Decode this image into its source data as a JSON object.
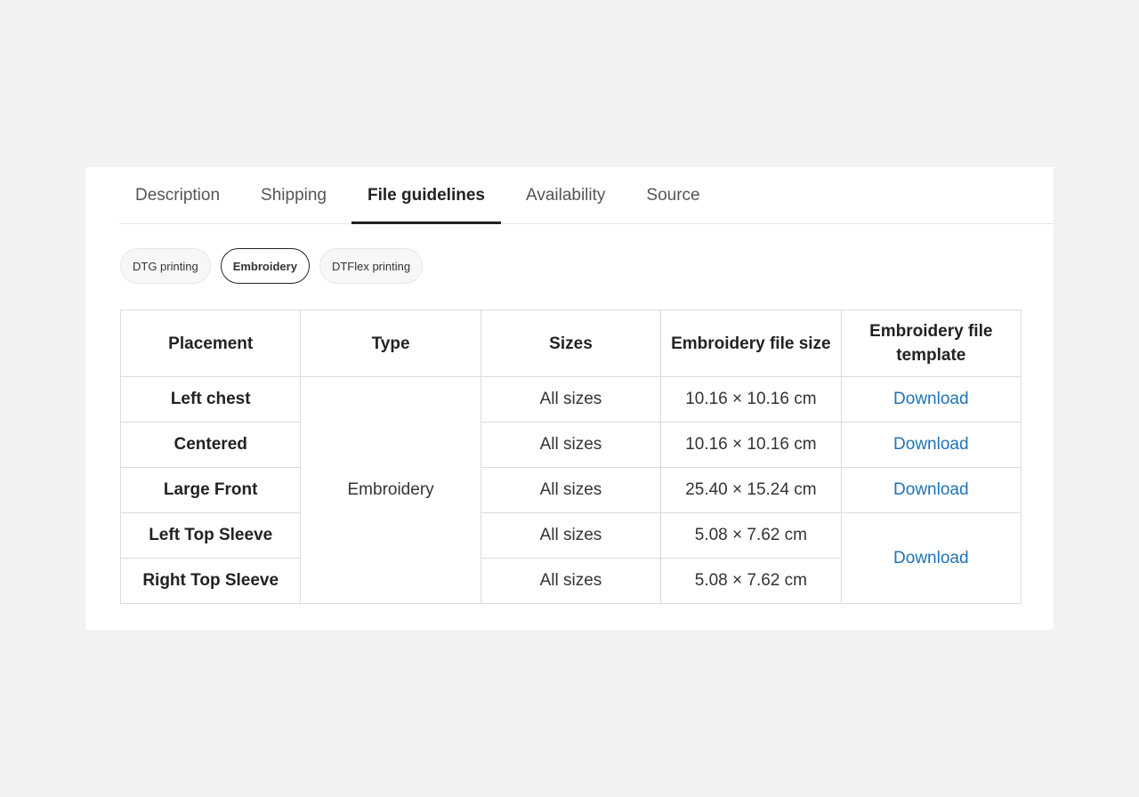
{
  "tabs": [
    {
      "label": "Description",
      "active": false
    },
    {
      "label": "Shipping",
      "active": false
    },
    {
      "label": "File guidelines",
      "active": true
    },
    {
      "label": "Availability",
      "active": false
    },
    {
      "label": "Source",
      "active": false
    }
  ],
  "pills": [
    {
      "label": "DTG printing",
      "active": false
    },
    {
      "label": "Embroidery",
      "active": true
    },
    {
      "label": "DTFlex printing",
      "active": false
    }
  ],
  "table": {
    "headers": [
      "Placement",
      "Type",
      "Sizes",
      "Embroidery file size",
      "Embroidery file template"
    ],
    "type_value": "Embroidery",
    "rows": [
      {
        "placement": "Left chest",
        "sizes": "All sizes",
        "file_size": "10.16 × 10.16 cm",
        "template": "Download"
      },
      {
        "placement": "Centered",
        "sizes": "All sizes",
        "file_size": "10.16 × 10.16 cm",
        "template": "Download"
      },
      {
        "placement": "Large Front",
        "sizes": "All sizes",
        "file_size": "25.40 × 15.24 cm",
        "template": "Download"
      },
      {
        "placement": "Left Top Sleeve",
        "sizes": "All sizes",
        "file_size": "5.08 × 7.62 cm",
        "template": "Download"
      },
      {
        "placement": "Right Top Sleeve",
        "sizes": "All sizes",
        "file_size": "5.08 × 7.62 cm"
      }
    ]
  },
  "colors": {
    "link": "#1f73b7",
    "background": "#f2f2f2",
    "card": "#ffffff"
  }
}
